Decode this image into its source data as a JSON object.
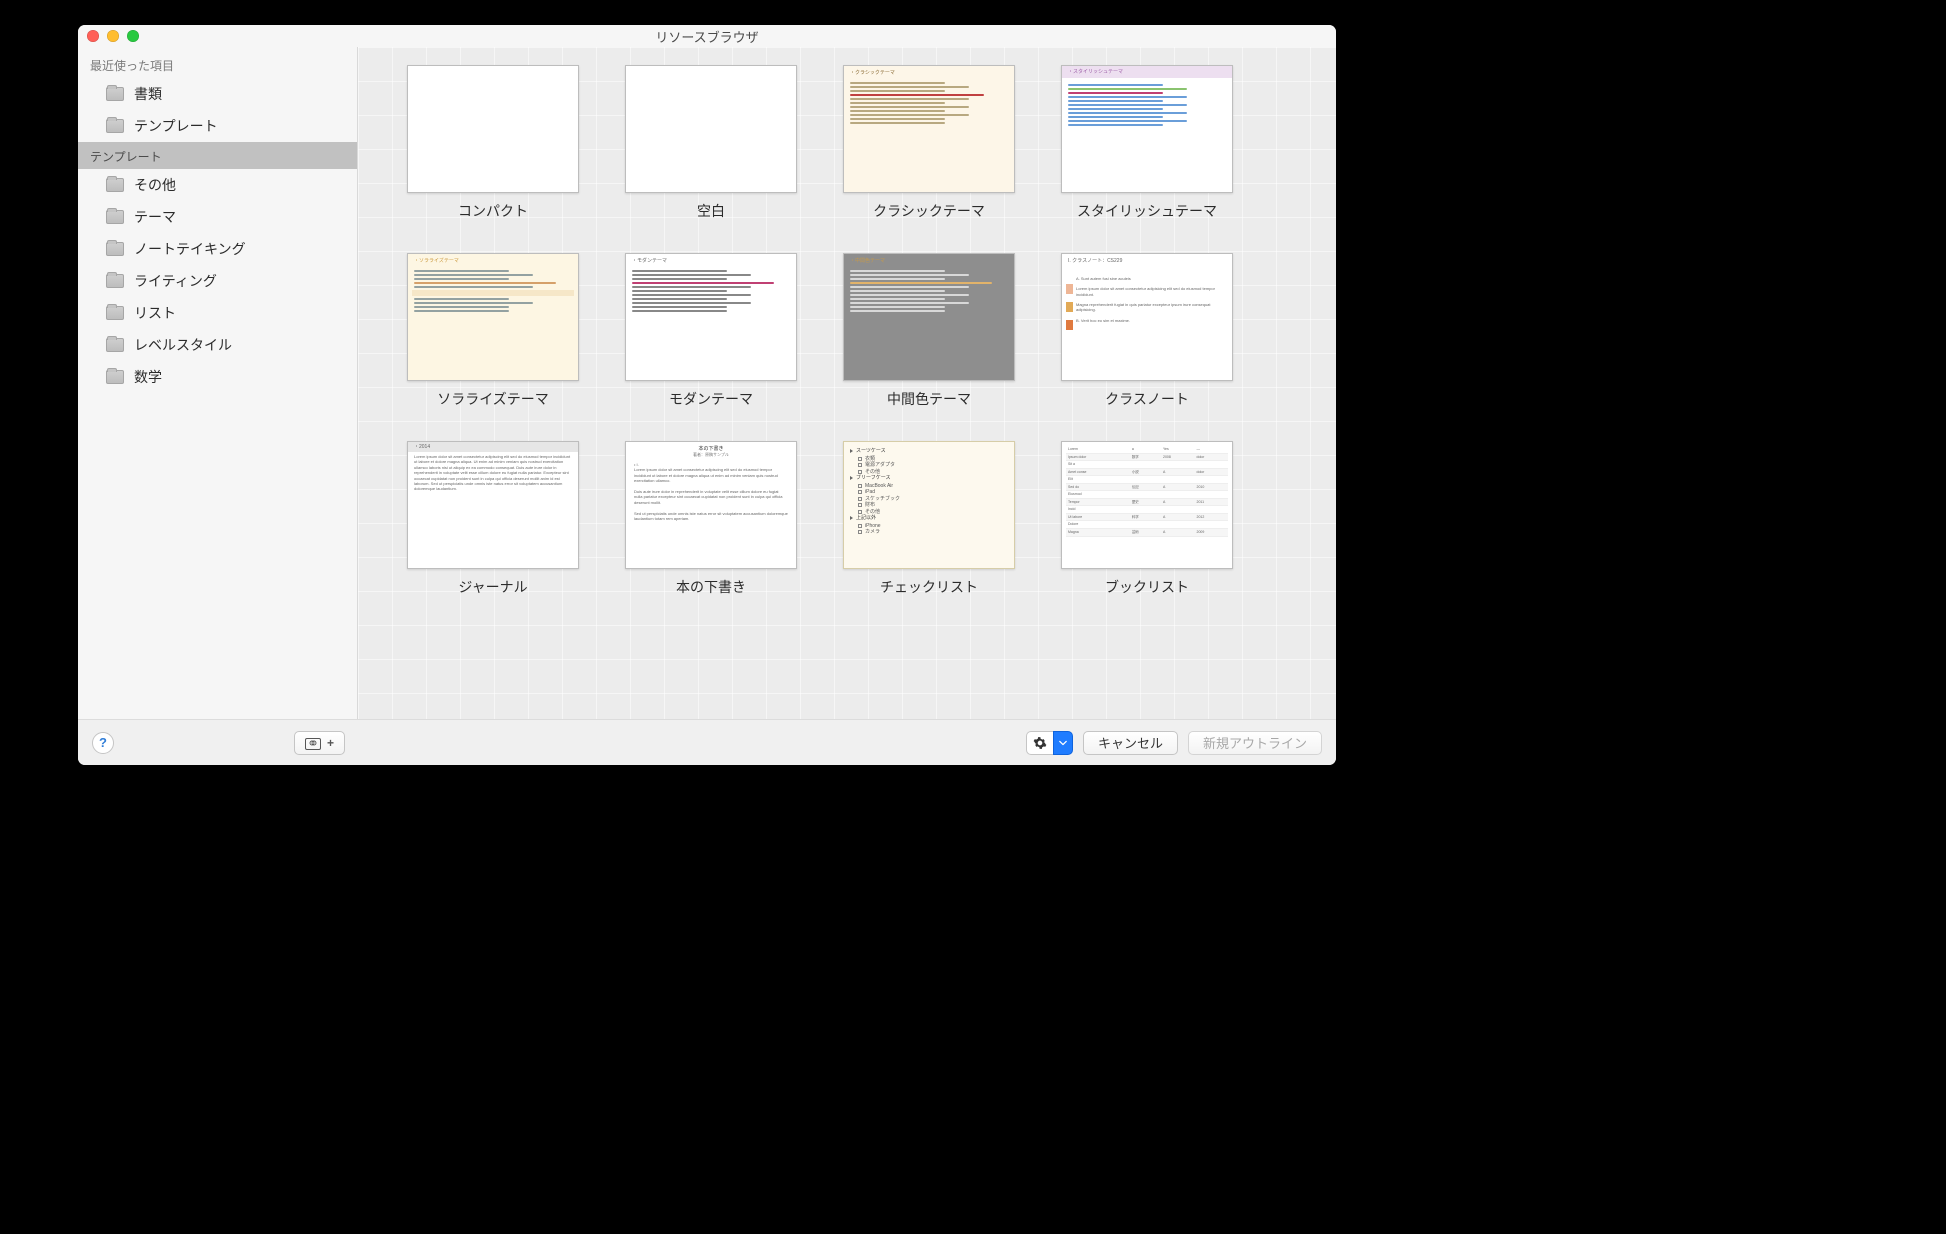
{
  "window_title": "リソースブラウザ",
  "sidebar": {
    "sections": [
      {
        "header": "最近使った項目",
        "header_selected": false,
        "items": [
          {
            "label": "書類"
          },
          {
            "label": "テンプレート"
          }
        ]
      },
      {
        "header": "テンプレート",
        "header_selected": true,
        "items": [
          {
            "label": "その他"
          },
          {
            "label": "テーマ"
          },
          {
            "label": "ノートテイキング"
          },
          {
            "label": "ライティング"
          },
          {
            "label": "リスト"
          },
          {
            "label": "レベルスタイル"
          },
          {
            "label": "数学"
          }
        ]
      }
    ]
  },
  "templates": [
    {
      "label": "コンパクト",
      "kind": "compact"
    },
    {
      "label": "空白",
      "kind": "blank"
    },
    {
      "label": "クラシックテーマ",
      "kind": "classic",
      "heading": "・クラシックテーマ"
    },
    {
      "label": "スタイリッシュテーマ",
      "kind": "stylish",
      "heading": "・スタイリッシュテーマ"
    },
    {
      "label": "ソラライズテーマ",
      "kind": "solar",
      "heading": "・ソラライズテーマ"
    },
    {
      "label": "モダンテーマ",
      "kind": "modern",
      "heading": "・モダンテーマ"
    },
    {
      "label": "中間色テーマ",
      "kind": "neutral",
      "heading": "・中間色テーマ"
    },
    {
      "label": "クラスノート",
      "kind": "notes",
      "heading": "I. クラスノート：CS229"
    },
    {
      "label": "ジャーナル",
      "kind": "journal",
      "heading": "・2014"
    },
    {
      "label": "本の下書き",
      "kind": "book",
      "heading": "本の下書き",
      "sub": "著者：原稿サンプル"
    },
    {
      "label": "チェックリスト",
      "kind": "check"
    },
    {
      "label": "ブックリスト",
      "kind": "list"
    }
  ],
  "checklist_preview": {
    "groups": [
      {
        "head": "スーツケース",
        "items": [
          "衣類",
          "電源アダプタ",
          "その他"
        ]
      },
      {
        "head": "ブリーフケース",
        "items": [
          "MacBook Air",
          "iPad",
          "スケッチブック",
          "財布",
          "その他"
        ]
      },
      {
        "head": "上記以外",
        "items": [
          "iPhone",
          "カメラ"
        ]
      }
    ]
  },
  "footer": {
    "help_tooltip": "ヘルプ",
    "import_tooltip": "リンクリソースを追加",
    "gear_tooltip": "アクション",
    "cancel": "キャンセル",
    "create": "新規アウトライン"
  }
}
